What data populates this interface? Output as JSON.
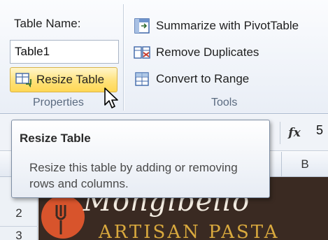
{
  "ribbon": {
    "properties": {
      "table_name_label": "Table Name:",
      "table_name_value": "Table1",
      "resize_table_label": "Resize Table",
      "group_label": "Properties"
    },
    "tools": {
      "items": [
        {
          "label": "Summarize with PivotTable",
          "icon": "pivot-table-icon"
        },
        {
          "label": "Remove Duplicates",
          "icon": "remove-duplicates-icon"
        },
        {
          "label": "Convert to Range",
          "icon": "convert-to-range-icon"
        }
      ],
      "group_label": "Tools"
    }
  },
  "formula_bar": {
    "fx_label": "fx",
    "value": "5"
  },
  "columns": {
    "b_label": "B"
  },
  "rows": [
    "2",
    "3"
  ],
  "tooltip": {
    "title": "Resize Table",
    "description": "Resize this table by adding or removing rows and columns."
  },
  "logo": {
    "name": "Mongibello",
    "subtitle": "ARTISAN PASTA"
  },
  "colors": {
    "highlight": "#ffe27a",
    "ribbon_bg": "#e9eef6",
    "logo_bg": "#3a2a22",
    "logo_accent": "#d8542c"
  }
}
